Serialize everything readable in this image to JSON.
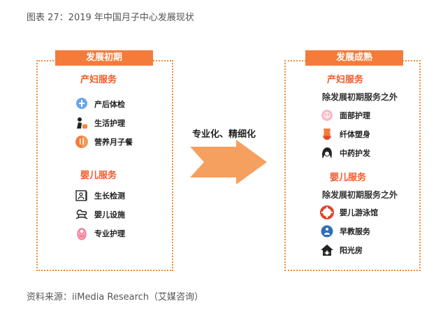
{
  "figure_title": "图表 27：2019 年中国月子中心发展现状",
  "source": "资料来源：iiMedia Research（艾媒咨询）",
  "left": {
    "tag": "发展初期",
    "maternal": {
      "title": "产妇服务",
      "items": [
        "产后体检",
        "生活护理",
        "营养月子餐"
      ]
    },
    "infant": {
      "title": "婴儿服务",
      "items": [
        "生长检测",
        "婴儿设施",
        "专业护理"
      ]
    }
  },
  "arrow_label": "专业化、精细化",
  "right": {
    "tag": "发展成熟",
    "maternal": {
      "title": "产妇服务",
      "subtitle": "除发展初期服务之外",
      "items": [
        "面部护理",
        "纤体塑身",
        "中药护发"
      ]
    },
    "infant": {
      "title": "婴儿服务",
      "subtitle": "除发展初期服务之外",
      "items": [
        "婴儿游泳馆",
        "早教服务",
        "阳光房"
      ]
    }
  },
  "colors": {
    "accent": "#f47b3a",
    "section_title": "#f05a28",
    "arrow": "#f5a05f"
  }
}
